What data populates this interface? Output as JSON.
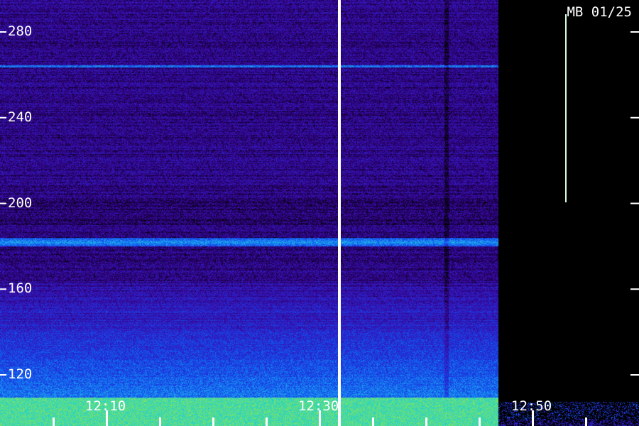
{
  "header": {
    "station": "MB 01/25"
  },
  "chart_data": {
    "type": "heatmap",
    "title": "",
    "xlabel": "",
    "ylabel": "",
    "ylim": [
      105,
      290
    ],
    "y_ticks": [
      120,
      160,
      200,
      240,
      280
    ],
    "x_ticks": [
      "12:10",
      "12:30",
      "12:50"
    ],
    "xlim_minutes": [
      "12:02",
      "12:60"
    ],
    "colormap": [
      "#000000",
      "#2a0070",
      "#3a10b0",
      "#1f2fd8",
      "#1060f0",
      "#1e9cf2",
      "#20d0d0",
      "#b8f020"
    ],
    "features": [
      {
        "label": "bright band",
        "freq": 182
      },
      {
        "label": "thin line",
        "freq": 264
      },
      {
        "label": "data gap",
        "time": "12:30"
      },
      {
        "label": "end of record",
        "time": "12:48"
      }
    ]
  }
}
